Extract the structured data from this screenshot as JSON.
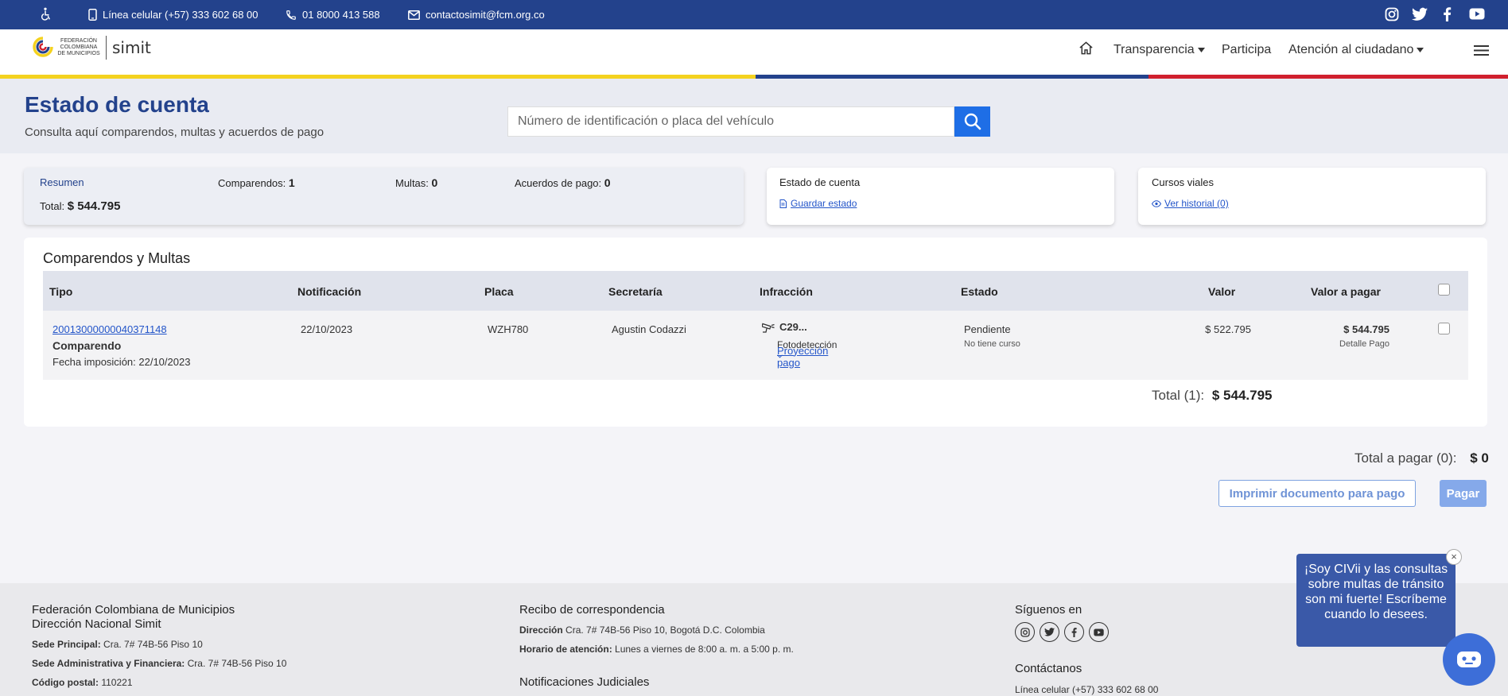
{
  "topbar": {
    "accessibility_icon": "wheelchair-icon",
    "phone_mobile": "Línea celular (+57) 333 602 68 00",
    "phone_landline": "01 8000 413 588",
    "email": "contactosimit@fcm.org.co",
    "social": [
      "instagram-icon",
      "twitter-icon",
      "facebook-icon",
      "youtube-icon"
    ],
    "bg_color": "#23428c"
  },
  "header": {
    "logo_text": "FEDERACIÓN COLOMBIANA DE MUNICIPIOS",
    "logo_brand": "simit",
    "nav": {
      "home_icon": "home-icon",
      "transparencia": "Transparencia",
      "participa": "Participa",
      "atencion": "Atención al ciudadano",
      "menu_icon": "hamburger-icon"
    },
    "stripe_colors": [
      "#f4d21f",
      "#23428c",
      "#d0202e"
    ]
  },
  "hero": {
    "title": "Estado de cuenta",
    "subtitle": "Consulta aquí comparendos, multas y acuerdos de pago",
    "search_placeholder": "Número de identificación o placa del vehículo",
    "search_icon": "search-icon"
  },
  "resumen": {
    "label": "Resumen",
    "comparendos_label": "Comparendos:",
    "comparendos_value": "1",
    "multas_label": "Multas:",
    "multas_value": "0",
    "acuerdos_label": "Acuerdos de pago:",
    "acuerdos_value": "0",
    "total_label": "Total:",
    "total_value": "$ 544.795"
  },
  "estado_card": {
    "title": "Estado de cuenta",
    "link": "Guardar estado",
    "icon": "document-icon"
  },
  "cursos_card": {
    "title": "Cursos viales",
    "link": "Ver historial (0)",
    "icon": "eye-icon"
  },
  "table": {
    "title": "Comparendos y Multas",
    "headers": {
      "tipo": "Tipo",
      "notificacion": "Notificación",
      "placa": "Placa",
      "secretaria": "Secretaría",
      "infraccion": "Infracción",
      "estado": "Estado",
      "valor": "Valor",
      "valor_pagar": "Valor a pagar"
    },
    "row": {
      "numero": "20013000000040371148",
      "tipo": "Comparendo",
      "fecha": "Fecha imposición: 22/10/2023",
      "notificacion": "22/10/2023",
      "placa": "WZH780",
      "secretaria": "Agustin Codazzi",
      "infraccion_code": "C29...",
      "infraccion_icon": "speed-camera-icon",
      "infraccion_tipo": "Fotodetección",
      "proyeccion": "Proyección pago",
      "estado": "Pendiente",
      "curso": "No tiene curso",
      "valor": "$ 522.795",
      "valor_pagar": "$ 544.795",
      "detalle": "Detalle Pago"
    },
    "total_label": "Total (1):",
    "total_value": "$ 544.795"
  },
  "pagar": {
    "total_label": "Total a pagar (0):",
    "total_value": "$ 0",
    "print_button": "Imprimir documento para pago",
    "pay_button": "Pagar"
  },
  "footer": {
    "org": "Federación Colombiana de Municipios",
    "dir": "Dirección Nacional Simit",
    "sede_label": "Sede Principal:",
    "sede_value": "Cra. 7# 74B-56 Piso 10",
    "sede_admin_label": "Sede Administrativa y Financiera:",
    "sede_admin_value": "Cra. 7# 74B-56 Piso 10",
    "postal_label": "Código postal:",
    "postal_value": "110221",
    "recibo_title": "Recibo de correspondencia",
    "direccion_label": "Dirección",
    "direccion_value": "Cra. 7# 74B-56 Piso 10, Bogotá D.C. Colombia",
    "horario_label": "Horario de atención:",
    "horario_value": "Lunes a viernes de 8:00 a. m. a 5:00 p. m.",
    "notif_title": "Notificaciones Judiciales",
    "siguenos": "Síguenos en",
    "contactanos": "Contáctanos",
    "linea": "Línea celular (+57) 333 602 68 00"
  },
  "chat": {
    "message": "¡Soy CIVii y las consultas sobre multas de tránsito son mi fuerte! Escríbeme cuando lo desees.",
    "close": "×",
    "bot_icon": "chatbot-icon"
  }
}
